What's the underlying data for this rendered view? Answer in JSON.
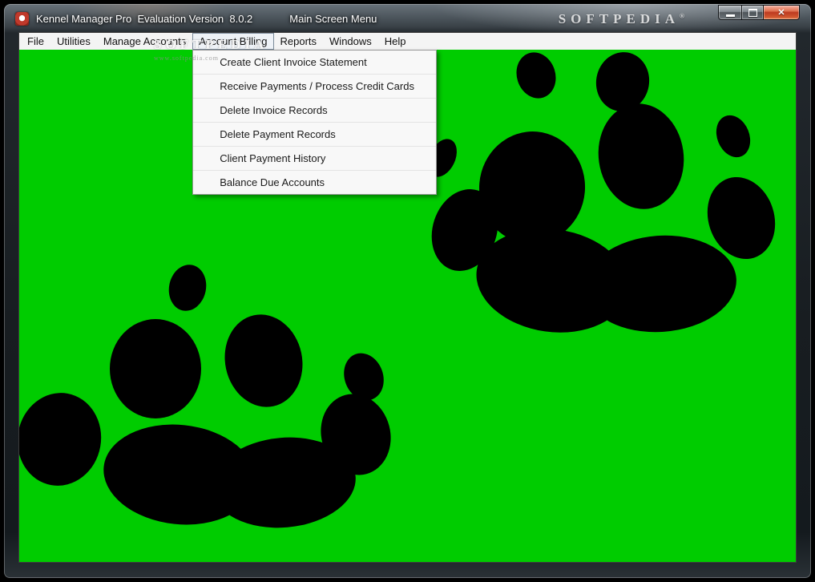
{
  "window": {
    "title_left": "Kennel Manager Pro  Evaluation Version  8.0.2",
    "title_right": "Main Screen Menu",
    "controls": {
      "minimize_icon": "minimize-bar",
      "maximize_icon": "maximize-square",
      "close_glyph": "✕"
    }
  },
  "watermarks": {
    "titlebar_text": "SOFTPEDIA",
    "registered_mark": "®",
    "menu_text": "SOFTPEDIA",
    "menu_url": "www.softpedia.com"
  },
  "menubar": {
    "items": [
      {
        "label": "File",
        "active": false
      },
      {
        "label": "Utilities",
        "active": false
      },
      {
        "label": "Manage Accounts",
        "active": false
      },
      {
        "label": "Account Billing",
        "active": true
      },
      {
        "label": "Reports",
        "active": false
      },
      {
        "label": "Windows",
        "active": false
      },
      {
        "label": "Help",
        "active": false
      }
    ]
  },
  "dropdown": {
    "items": [
      "Create Client Invoice Statement",
      "Receive Payments / Process Credit Cards",
      "Delete Invoice Records",
      "Delete Payment Records",
      "Client Payment History",
      "Balance Due Accounts"
    ]
  },
  "colors": {
    "canvas_green": "#00cc00",
    "paw_black": "#000000",
    "close_red": "#bd3a20",
    "titlebar_dark": "#22282d"
  }
}
